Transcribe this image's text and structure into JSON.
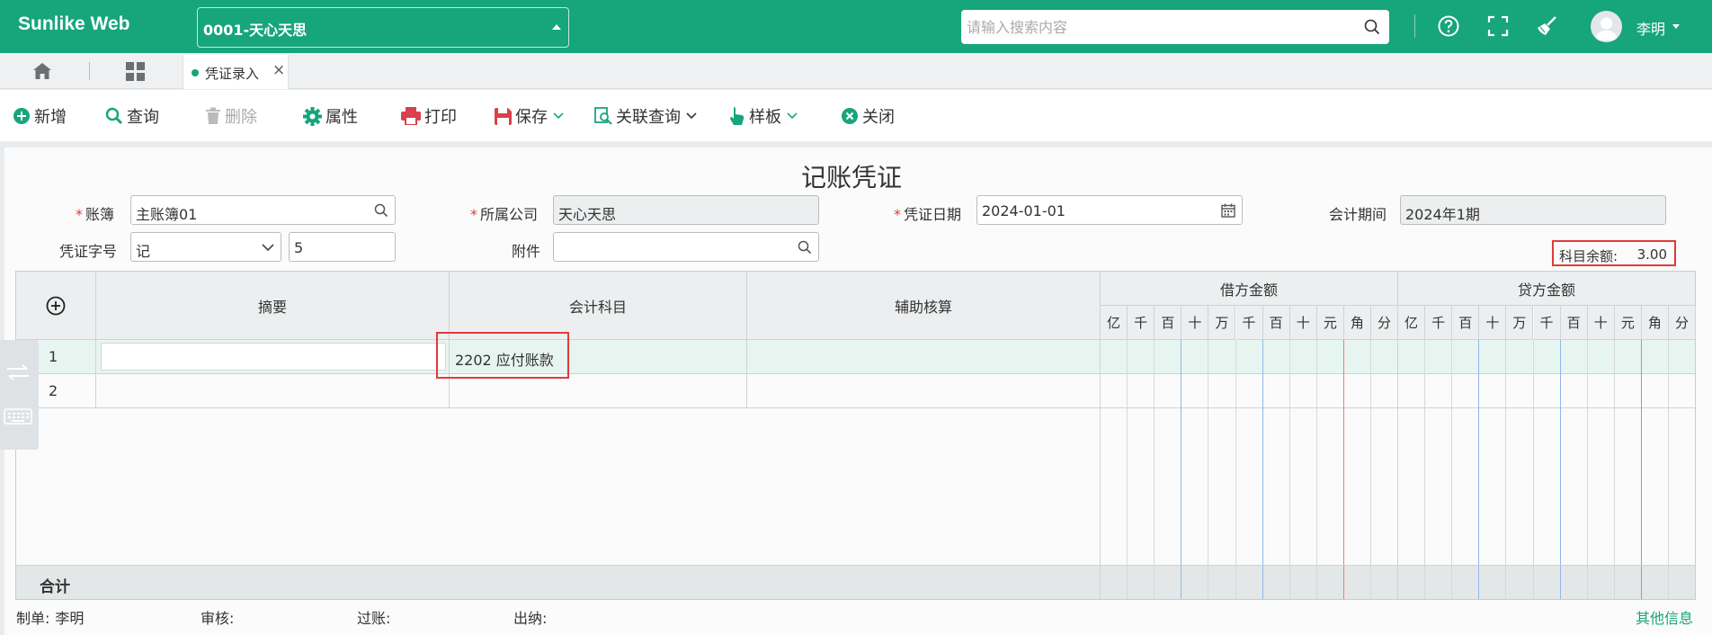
{
  "topbar": {
    "brand": "Sunlike Web",
    "org_selected": "0001-天心天思",
    "search_placeholder": "请输入搜索内容",
    "user_name": "李明"
  },
  "tabs": {
    "active_tab": "凭证录入"
  },
  "toolbar": {
    "add": "新增",
    "query": "查询",
    "delete": "删除",
    "properties": "属性",
    "print": "打印",
    "save": "保存",
    "linked_query": "关联查询",
    "template": "样板",
    "close": "关闭"
  },
  "form": {
    "title": "记账凭证",
    "ledger_label": "账簿",
    "ledger_value": "主账簿01",
    "company_label": "所属公司",
    "company_value": "天心天思",
    "date_label": "凭证日期",
    "date_value": "2024-01-01",
    "period_label": "会计期间",
    "period_value": "2024年1期",
    "voucher_no_label": "凭证字号",
    "voucher_word": "记",
    "voucher_number": "5",
    "attachment_label": "附件",
    "attachment_value": "",
    "balance_label": "科目余额:",
    "balance_value": "3.00"
  },
  "grid": {
    "headers": {
      "summary": "摘要",
      "account": "会计科目",
      "auxiliary": "辅助核算",
      "debit": "借方金额",
      "credit": "贷方金额"
    },
    "digit_labels": [
      "亿",
      "千",
      "百",
      "十",
      "万",
      "千",
      "百",
      "十",
      "元",
      "角",
      "分"
    ],
    "rows": [
      {
        "no": "1",
        "summary": "",
        "account": "2202 应付账款",
        "auxiliary": ""
      },
      {
        "no": "2",
        "summary": "",
        "account": "",
        "auxiliary": ""
      }
    ],
    "total_label": "合计"
  },
  "footer": {
    "maker_label": "制单:",
    "maker_value": "李明",
    "auditor_label": "审核:",
    "posting_label": "过账:",
    "cashier_label": "出纳:",
    "other_info": "其他信息"
  },
  "colors": {
    "brand_green": "#17a57c",
    "highlight_red": "#e23a3a",
    "active_row": "#e7f5f0"
  }
}
